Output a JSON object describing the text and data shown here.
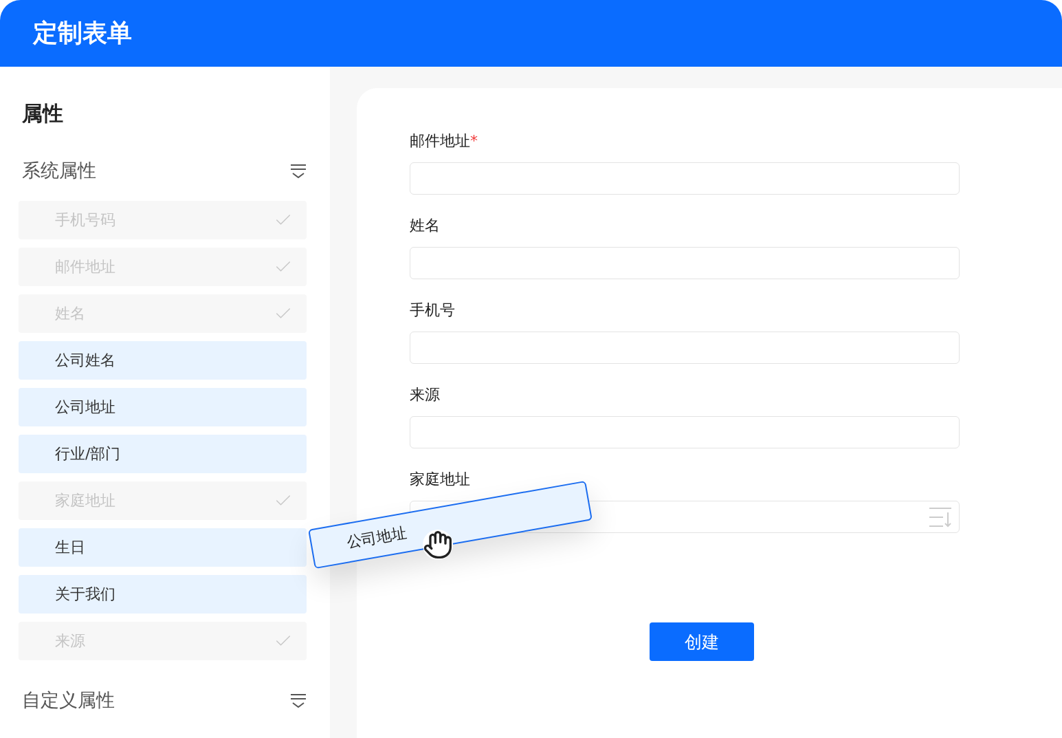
{
  "header": {
    "title": "定制表单"
  },
  "sidebar": {
    "title": "属性",
    "sections": [
      {
        "title": "系统属性",
        "items": [
          {
            "label": "手机号码",
            "used": true
          },
          {
            "label": "邮件地址",
            "used": true
          },
          {
            "label": "姓名",
            "used": true
          },
          {
            "label": "公司姓名",
            "used": false
          },
          {
            "label": "公司地址",
            "used": false
          },
          {
            "label": "行业/部门",
            "used": false
          },
          {
            "label": "家庭地址",
            "used": true
          },
          {
            "label": "生日",
            "used": false
          },
          {
            "label": "关于我们",
            "used": false
          },
          {
            "label": "来源",
            "used": true
          }
        ]
      },
      {
        "title": "自定义属性"
      }
    ]
  },
  "form": {
    "fields": [
      {
        "label": "邮件地址",
        "required_mark": "*",
        "kind": "text"
      },
      {
        "label": "姓名",
        "kind": "text"
      },
      {
        "label": "手机号",
        "kind": "text"
      },
      {
        "label": "来源",
        "kind": "text"
      },
      {
        "label": "家庭地址",
        "kind": "textarea"
      }
    ],
    "submit": "创建"
  },
  "drag_item": {
    "label": "公司地址"
  }
}
